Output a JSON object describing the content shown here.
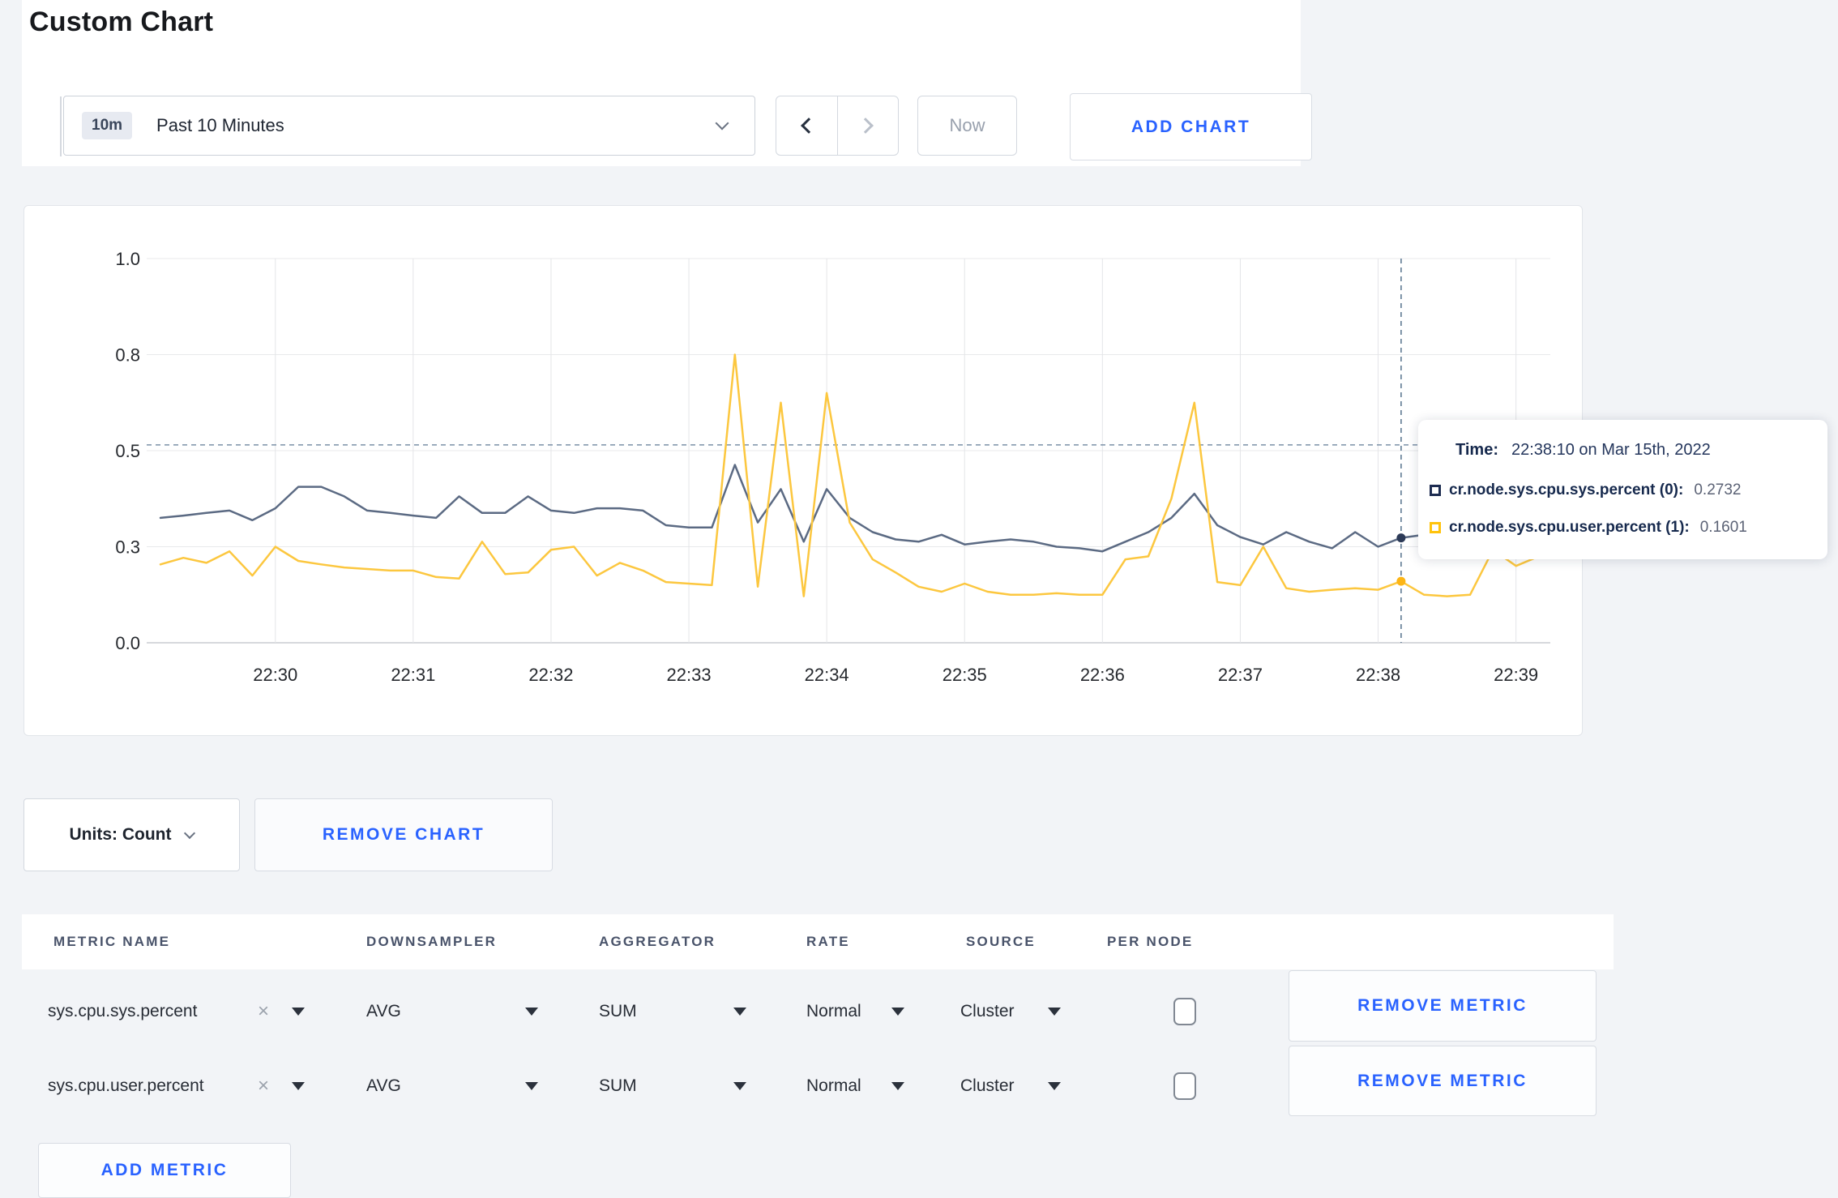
{
  "page": {
    "title": "Custom Chart",
    "background": "#f2f4f7",
    "accent_blue": "#2962ff"
  },
  "toolbar": {
    "time_range_badge": "10m",
    "time_range_label": "Past 10 Minutes",
    "now_label": "Now",
    "add_chart_label": "ADD CHART"
  },
  "chart_data": {
    "type": "line",
    "x_axis": {
      "start": "22:29:10",
      "end": "22:39:10",
      "interval_seconds": 10,
      "ticks": [
        {
          "label": "22:30",
          "t": 50
        },
        {
          "label": "22:31",
          "t": 110
        },
        {
          "label": "22:32",
          "t": 170
        },
        {
          "label": "22:33",
          "t": 230
        },
        {
          "label": "22:34",
          "t": 290
        },
        {
          "label": "22:35",
          "t": 350
        },
        {
          "label": "22:36",
          "t": 410
        },
        {
          "label": "22:37",
          "t": 470
        },
        {
          "label": "22:38",
          "t": 530
        },
        {
          "label": "22:39",
          "t": 590
        }
      ]
    },
    "y_axis": {
      "min": 0,
      "max": 1,
      "ticks": [
        {
          "label": "1.0",
          "value": 1.0
        },
        {
          "label": "0.8",
          "value": 0.75
        },
        {
          "label": "0.5",
          "value": 0.5
        },
        {
          "label": "0.3",
          "value": 0.25
        },
        {
          "label": "0.0",
          "value": 0.0
        }
      ]
    },
    "grid": true,
    "guideline_value": 0.515,
    "crosshair": {
      "t": 540,
      "time": "22:38:10",
      "index": 54
    },
    "series": [
      {
        "name": "cr.node.sys.cpu.sys.percent (0)",
        "color": "#5b6a83",
        "dot_color": "#2c3a57",
        "values": [
          0.325,
          0.331,
          0.338,
          0.344,
          0.319,
          0.35,
          0.406,
          0.406,
          0.381,
          0.344,
          0.338,
          0.331,
          0.325,
          0.381,
          0.338,
          0.338,
          0.381,
          0.344,
          0.338,
          0.35,
          0.35,
          0.344,
          0.306,
          0.3,
          0.3,
          0.463,
          0.313,
          0.4,
          0.263,
          0.4,
          0.325,
          0.288,
          0.269,
          0.263,
          0.281,
          0.256,
          0.263,
          0.269,
          0.263,
          0.25,
          0.246,
          0.238,
          0.263,
          0.288,
          0.325,
          0.388,
          0.306,
          0.275,
          0.256,
          0.288,
          0.263,
          0.246,
          0.288,
          0.25,
          0.273,
          0.281,
          0.25,
          0.246,
          0.25,
          0.263,
          0.25
        ]
      },
      {
        "name": "cr.node.sys.cpu.user.percent (1)",
        "color": "#fcc73f",
        "dot_color": "#fdb515",
        "values": [
          0.204,
          0.221,
          0.208,
          0.238,
          0.175,
          0.25,
          0.213,
          0.204,
          0.196,
          0.192,
          0.188,
          0.188,
          0.171,
          0.167,
          0.263,
          0.179,
          0.183,
          0.242,
          0.25,
          0.175,
          0.208,
          0.188,
          0.158,
          0.154,
          0.15,
          0.75,
          0.146,
          0.625,
          0.121,
          0.65,
          0.313,
          0.217,
          0.183,
          0.146,
          0.133,
          0.154,
          0.133,
          0.125,
          0.125,
          0.129,
          0.125,
          0.125,
          0.217,
          0.225,
          0.375,
          0.625,
          0.158,
          0.15,
          0.25,
          0.142,
          0.133,
          0.138,
          0.142,
          0.138,
          0.16,
          0.125,
          0.121,
          0.125,
          0.242,
          0.2,
          0.225
        ]
      }
    ]
  },
  "tooltip": {
    "time_label": "Time:",
    "time_value": "22:38:10 on Mar 15th, 2022",
    "entries": [
      {
        "label": "cr.node.sys.cpu.sys.percent (0):",
        "value": "0.2732",
        "color": "#1d2c51"
      },
      {
        "label": "cr.node.sys.cpu.user.percent (1):",
        "value": "0.1601",
        "color": "#ffc30d"
      }
    ]
  },
  "chart_footer": {
    "units_label": "Units: Count",
    "remove_chart_label": "REMOVE CHART"
  },
  "metrics_table": {
    "headers": [
      "METRIC NAME",
      "DOWNSAMPLER",
      "AGGREGATOR",
      "RATE",
      "SOURCE",
      "PER NODE"
    ],
    "clear_glyph": "×",
    "rows": [
      {
        "name": "sys.cpu.sys.percent",
        "downsampler": "AVG",
        "aggregator": "SUM",
        "rate": "Normal",
        "source": "Cluster",
        "per_node_checked": false,
        "remove_label": "REMOVE METRIC"
      },
      {
        "name": "sys.cpu.user.percent",
        "downsampler": "AVG",
        "aggregator": "SUM",
        "rate": "Normal",
        "source": "Cluster",
        "per_node_checked": false,
        "remove_label": "REMOVE METRIC"
      }
    ],
    "add_metric_label": "ADD METRIC"
  }
}
